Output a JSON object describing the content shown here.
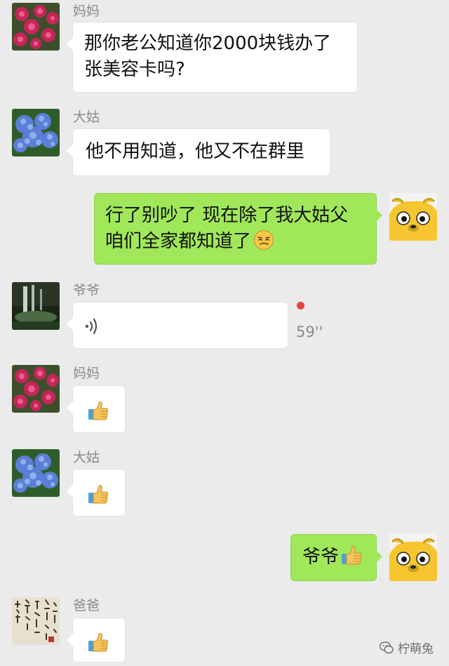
{
  "messages": [
    {
      "sender": "妈妈",
      "text_line1": "那你老公知道你2000块钱办了",
      "text_line2": "张美容卡吗?"
    },
    {
      "sender": "大姑",
      "text": "他不用知道，他又不在群里"
    },
    {
      "self": true,
      "text_line1": "行了别吵了 现在除了我大姑父",
      "text_line2": "咱们全家都知道了",
      "emoji": "smug-face-emoji"
    },
    {
      "sender": "爷爷",
      "voice_duration": "59''"
    },
    {
      "sender": "妈妈",
      "emoji": "thumbs-up-emoji"
    },
    {
      "sender": "大姑",
      "emoji": "thumbs-up-emoji"
    },
    {
      "self": true,
      "text": "爷爷",
      "emoji": "thumbs-up-emoji"
    },
    {
      "sender": "爸爸",
      "emoji": "thumbs-up-emoji"
    }
  ],
  "watermark": {
    "text": "柠萌兔",
    "icon": "wechat-icon"
  },
  "colors": {
    "background": "#ebebeb",
    "self_bubble": "#a0e75a",
    "other_bubble": "#ffffff",
    "unread_dot": "#e64340"
  }
}
